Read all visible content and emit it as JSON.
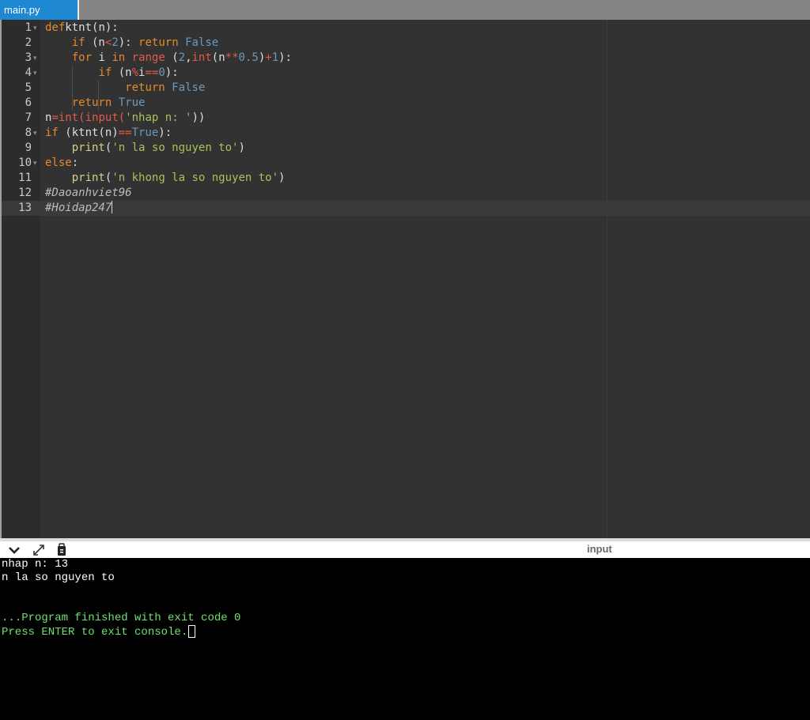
{
  "tab": {
    "filename": "main.py"
  },
  "editor": {
    "line_numbers": [
      "1",
      "2",
      "3",
      "4",
      "5",
      "6",
      "7",
      "8",
      "9",
      "10",
      "11",
      "12",
      "13"
    ],
    "lines": [
      [
        [
          "kw",
          "def"
        ],
        [
          "",
          "ktnt(n):"
        ]
      ],
      [
        [
          "",
          "    "
        ],
        [
          "kw",
          "if"
        ],
        [
          "",
          " (n"
        ],
        [
          "op",
          "<"
        ],
        [
          "num",
          "2"
        ],
        [
          "",
          "): "
        ],
        [
          "kw",
          "return"
        ],
        [
          "",
          " "
        ],
        [
          "bool",
          "False"
        ]
      ],
      [
        [
          "",
          "    "
        ],
        [
          "kw",
          "for"
        ],
        [
          "",
          " i "
        ],
        [
          "kw",
          "in"
        ],
        [
          "",
          " "
        ],
        [
          "fn",
          "range"
        ],
        [
          "",
          " ("
        ],
        [
          "num",
          "2"
        ],
        [
          "",
          ","
        ],
        [
          "fn",
          "int"
        ],
        [
          "",
          "(n"
        ],
        [
          "op",
          "**"
        ],
        [
          "num",
          "0.5"
        ],
        [
          "",
          ")"
        ],
        [
          "op",
          "+"
        ],
        [
          "num",
          "1"
        ],
        [
          "",
          "):"
        ]
      ],
      [
        [
          "",
          "        "
        ],
        [
          "kw",
          "if"
        ],
        [
          "",
          " (n"
        ],
        [
          "op",
          "%"
        ],
        [
          "",
          "i"
        ],
        [
          "op",
          "=="
        ],
        [
          "num",
          "0"
        ],
        [
          "",
          "):"
        ]
      ],
      [
        [
          "",
          "            "
        ],
        [
          "kw",
          "return"
        ],
        [
          "",
          " "
        ],
        [
          "bool",
          "False"
        ]
      ],
      [
        [
          "",
          "    "
        ],
        [
          "kw",
          "return"
        ],
        [
          "",
          " "
        ],
        [
          "bool",
          "True"
        ]
      ],
      [
        [
          "",
          "n"
        ],
        [
          "op",
          "="
        ],
        [
          "fn",
          "int"
        ],
        [
          "op",
          "("
        ],
        [
          "fn",
          "input"
        ],
        [
          "op",
          "("
        ],
        [
          "str",
          "'nhap n: '"
        ],
        [
          "",
          "))"
        ]
      ],
      [
        [
          "kw",
          "if"
        ],
        [
          "",
          " (ktnt(n)"
        ],
        [
          "op",
          "=="
        ],
        [
          "bool",
          "True"
        ],
        [
          "",
          "):"
        ]
      ],
      [
        [
          "",
          "    "
        ],
        [
          "bi",
          "print"
        ],
        [
          "",
          "("
        ],
        [
          "str",
          "'n la so nguyen to'"
        ],
        [
          "",
          ")"
        ]
      ],
      [
        [
          "kw",
          "else"
        ],
        [
          "",
          ":"
        ]
      ],
      [
        [
          "",
          "    "
        ],
        [
          "bi",
          "print"
        ],
        [
          "",
          "("
        ],
        [
          "str",
          "'n khong la so nguyen to'"
        ],
        [
          "",
          ")"
        ]
      ],
      [
        [
          "cm",
          "#Daoanhviet96"
        ]
      ],
      [
        [
          "cm",
          "#Hoidap247"
        ]
      ]
    ]
  },
  "console": {
    "input_label": "input",
    "lines": [
      {
        "text": "nhap n: 13",
        "style": "white"
      },
      {
        "text": "n la so nguyen to",
        "style": "white"
      },
      {
        "text": "",
        "style": "white"
      },
      {
        "text": "",
        "style": "white"
      },
      {
        "text": "...Program finished with exit code 0",
        "style": "green"
      },
      {
        "text": "Press ENTER to exit console.",
        "style": "green"
      }
    ]
  },
  "icons": [
    "collapse-chevron-icon",
    "expand-icon",
    "clear-console-icon"
  ],
  "colors": {
    "tab": "#1e88d2",
    "editor_bg": "#323232",
    "keyword": "#e58a2a",
    "string": "#a5c25c",
    "console_green": "#6ee26e"
  }
}
